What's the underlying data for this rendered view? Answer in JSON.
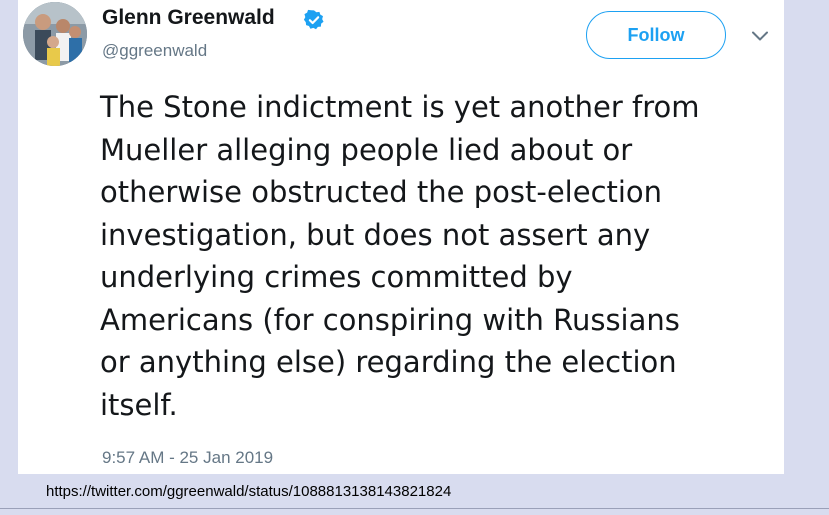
{
  "tweet": {
    "author": {
      "display_name": "Glenn Greenwald",
      "handle": "@ggreenwald",
      "verified": true,
      "avatar": "profile-photo"
    },
    "follow_label": "Follow",
    "menu_icon": "chevron-down-icon",
    "text_lines": [
      "The Stone indictment is yet another from",
      "Mueller alleging people lied about or",
      "otherwise obstructed the post-election",
      "investigation, but does not assert any",
      "underlying crimes committed by",
      "Americans (for conspiring with Russians",
      "or anything else) regarding the election",
      "itself."
    ],
    "timestamp": "9:57 AM - 25 Jan 2019"
  },
  "source_url": "https://twitter.com/ggreenwald/status/1088813138143821824",
  "colors": {
    "accent": "#1da1f2",
    "text": "#14171a",
    "secondary_text": "#657786",
    "page_background": "#d8dcef",
    "card_background": "#ffffff"
  }
}
